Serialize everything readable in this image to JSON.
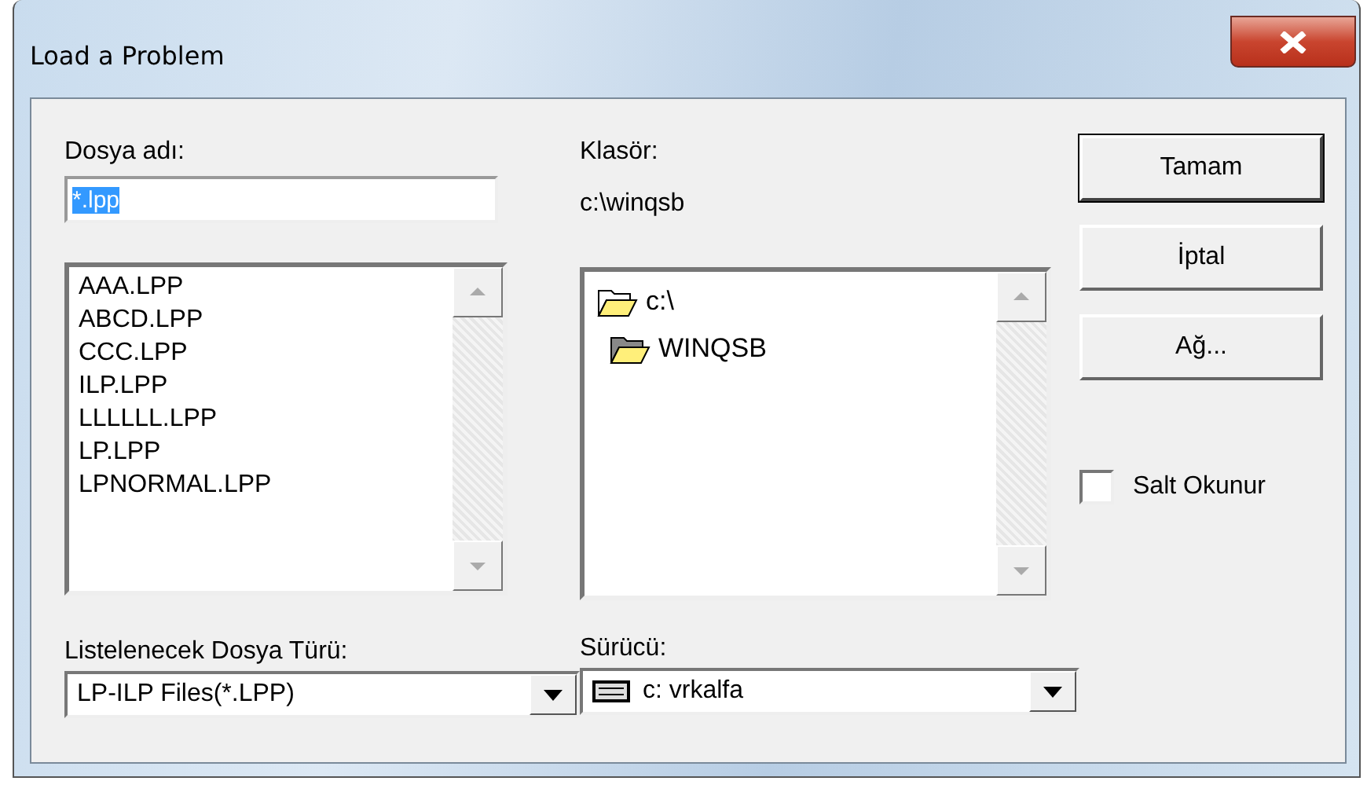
{
  "window": {
    "title": "Load a Problem"
  },
  "file_name": {
    "label": "Dosya adı:",
    "value": "*.lpp"
  },
  "files": [
    {
      "name": "AAA.LPP"
    },
    {
      "name": "ABCD.LPP"
    },
    {
      "name": "CCC.LPP"
    },
    {
      "name": "ILP.LPP"
    },
    {
      "name": "LLLLLL.LPP"
    },
    {
      "name": "LP.LPP"
    },
    {
      "name": "LPNORMAL.LPP"
    }
  ],
  "folder": {
    "label": "Klasör:",
    "path": "c:\\winqsb"
  },
  "folder_tree": [
    {
      "name": "c:\\",
      "children": [
        {
          "name": "WINQSB"
        }
      ]
    }
  ],
  "file_type": {
    "label": "Listelenecek Dosya Türü:",
    "value": "LP-ILP Files(*.LPP)"
  },
  "drive": {
    "label": "Sürücü:",
    "value": "c: vrkalfa"
  },
  "buttons": [
    {
      "label": "Tamam",
      "default": true
    },
    {
      "label": "İptal",
      "default": false
    },
    {
      "label": "Ağ...",
      "default": false
    }
  ],
  "read_only": {
    "label": "Salt Okunur",
    "checked": false
  }
}
